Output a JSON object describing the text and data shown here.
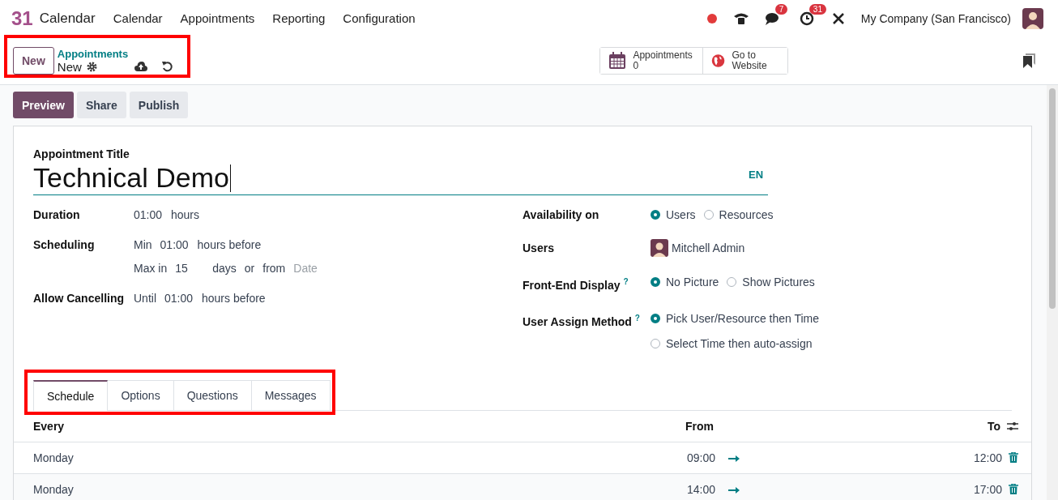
{
  "app": {
    "logo": "31",
    "name": "Calendar"
  },
  "menu": [
    "Calendar",
    "Appointments",
    "Reporting",
    "Configuration"
  ],
  "systray": {
    "messages_count": "7",
    "activities_count": "31",
    "company": "My Company (San Francisco)"
  },
  "control_panel": {
    "new_button": "New",
    "breadcrumb": "Appointments",
    "record": "New"
  },
  "smart_buttons": [
    {
      "kind": "calendar",
      "label": "Appointments",
      "value": "0"
    },
    {
      "kind": "globe",
      "label": "Go to Website"
    }
  ],
  "status_buttons": [
    {
      "label": "Preview",
      "selected": true
    },
    {
      "label": "Share",
      "selected": false
    },
    {
      "label": "Publish",
      "selected": false
    }
  ],
  "form": {
    "title_label": "Appointment Title",
    "title": "Technical Demo",
    "language": "EN",
    "left_fields": [
      {
        "label": "Duration",
        "lines": [
          [
            {
              "kind": "value",
              "text": "01:00"
            },
            {
              "kind": "text",
              "text": "hours"
            }
          ]
        ]
      },
      {
        "label": "Scheduling",
        "lines": [
          [
            {
              "kind": "text",
              "text": "Min"
            },
            {
              "kind": "value",
              "text": "01:00"
            },
            {
              "kind": "text",
              "text": "hours before"
            }
          ],
          [
            {
              "kind": "text",
              "text": "Max in"
            },
            {
              "kind": "value",
              "text": "15"
            },
            {
              "kind": "text",
              "text": "days"
            },
            {
              "kind": "text",
              "text": "or"
            },
            {
              "kind": "text",
              "text": "from"
            },
            {
              "kind": "placeholder",
              "text": "Date"
            }
          ]
        ]
      },
      {
        "label": "Allow Cancelling",
        "lines": [
          [
            {
              "kind": "text",
              "text": "Until"
            },
            {
              "kind": "value",
              "text": "01:00"
            },
            {
              "kind": "text",
              "text": "hours before"
            }
          ]
        ]
      }
    ],
    "right_fields": [
      {
        "label": "Availability on",
        "kind": "radio-row",
        "options": [
          {
            "label": "Users",
            "selected": true
          },
          {
            "label": "Resources",
            "selected": false
          }
        ]
      },
      {
        "label": "Users",
        "kind": "user",
        "user": "Mitchell Admin"
      },
      {
        "label": "Front-End Display",
        "help": "?",
        "kind": "radio-row",
        "options": [
          {
            "label": "No Picture",
            "selected": true
          },
          {
            "label": "Show Pictures",
            "selected": false
          }
        ]
      },
      {
        "label": "User Assign Method",
        "help": "?",
        "kind": "radio-column",
        "options": [
          {
            "label": "Pick User/Resource then Time",
            "selected": true
          },
          {
            "label": "Select Time then auto-assign",
            "selected": false
          }
        ]
      }
    ]
  },
  "tabs": [
    {
      "label": "Schedule",
      "selected": true
    },
    {
      "label": "Options",
      "selected": false
    },
    {
      "label": "Questions",
      "selected": false
    },
    {
      "label": "Messages",
      "selected": false
    }
  ],
  "table": {
    "columns": [
      "Every",
      "From",
      "To"
    ],
    "rows": [
      {
        "every": "Monday",
        "from": "09:00",
        "to": "12:00"
      },
      {
        "every": "Monday",
        "from": "14:00",
        "to": "17:00"
      }
    ]
  }
}
